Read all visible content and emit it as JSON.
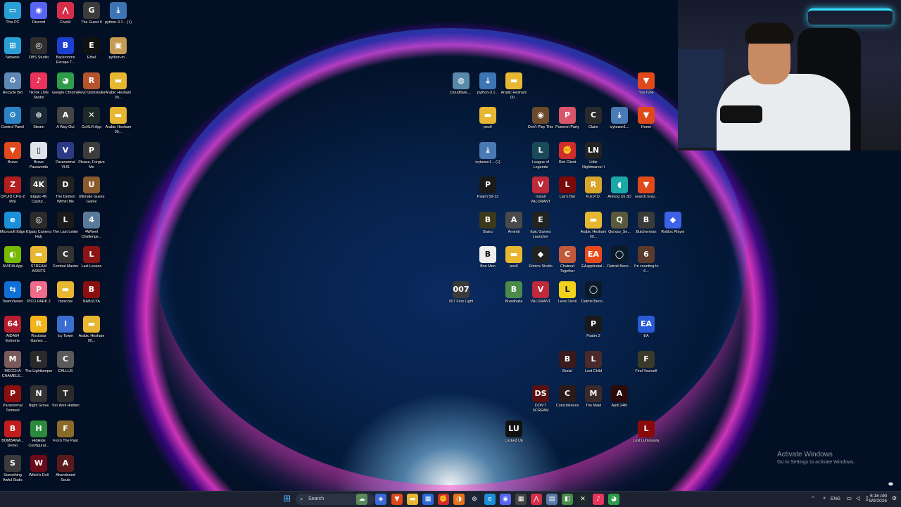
{
  "desktop_icons": [
    {
      "label": "This PC",
      "icon": "monitor-icon",
      "color": "#2a9fd6",
      "glyph": "▭"
    },
    {
      "label": "Discord",
      "icon": "discord-icon",
      "color": "#5865f2",
      "glyph": "◉"
    },
    {
      "label": "FiveM",
      "icon": "fivem-icon",
      "color": "#d62d4b",
      "glyph": "⋀"
    },
    {
      "label": "The Guest II",
      "icon": "game-icon",
      "color": "#3b3b3b",
      "glyph": "G"
    },
    {
      "label": "python-3.1... (1)",
      "icon": "python-installer-icon",
      "color": "#3c74b4",
      "glyph": "⤓"
    },
    {
      "label": "Network",
      "icon": "network-icon",
      "color": "#2a9fd6",
      "glyph": "⊞"
    },
    {
      "label": "OBS Studio",
      "icon": "obs-icon",
      "color": "#2e2e2e",
      "glyph": "◎"
    },
    {
      "label": "Backrooms Escape T...",
      "icon": "backrooms-icon",
      "color": "#1c3fd1",
      "glyph": "B"
    },
    {
      "label": "Ethel",
      "icon": "game-icon",
      "color": "#111",
      "glyph": "E"
    },
    {
      "label": "python-m...",
      "icon": "package-icon",
      "color": "#c59a52",
      "glyph": "▣"
    },
    {
      "label": "Recycle Bin",
      "icon": "recycle-bin-icon",
      "color": "#5f88b5",
      "glyph": "♻"
    },
    {
      "label": "TikTok LIVE Studio",
      "icon": "tiktok-icon",
      "color": "#e8335a",
      "glyph": "♪"
    },
    {
      "label": "Google Chrome",
      "icon": "chrome-icon",
      "color": "#2f9c4b",
      "glyph": "◕"
    },
    {
      "label": "Revo Uninstaller",
      "icon": "revo-icon",
      "color": "#b3542d",
      "glyph": "R"
    },
    {
      "label": "Arabic Hesham 00...",
      "icon": "folder-icon",
      "color": "#e7b731",
      "glyph": "▬"
    },
    {
      "label": "Control Panel",
      "icon": "control-panel-icon",
      "color": "#2d82c4",
      "glyph": "⚙"
    },
    {
      "label": "Steam",
      "icon": "steam-icon",
      "color": "#1b2838",
      "glyph": "⊛"
    },
    {
      "label": "A Way Out",
      "icon": "game-icon",
      "color": "#444",
      "glyph": "A"
    },
    {
      "label": "GoXLR App",
      "icon": "goxlr-icon",
      "color": "#1e2a2a",
      "glyph": "✕"
    },
    {
      "label": "Arabic Hesham 00...",
      "icon": "folder-icon",
      "color": "#e7b731",
      "glyph": "▬"
    },
    {
      "label": "Brave",
      "icon": "brave-icon",
      "color": "#e04a1b",
      "glyph": "▼"
    },
    {
      "label": "Brave Passwords",
      "icon": "file-icon",
      "color": "#dfe3ea",
      "glyph": "▯"
    },
    {
      "label": "Paranormal VHS",
      "icon": "vhs-icon",
      "color": "#2c3a86",
      "glyph": "V"
    },
    {
      "label": "Please, Forgive Me",
      "icon": "game-icon",
      "color": "#3c3c3c",
      "glyph": "P"
    },
    {
      "label": "CPUID CPU-Z MSI",
      "icon": "cpuz-icon",
      "color": "#b41e1e",
      "glyph": "Z"
    },
    {
      "label": "Elgato 4K Captur...",
      "icon": "elgato-icon",
      "color": "#333",
      "glyph": "4K"
    },
    {
      "label": "The Demon Within Me",
      "icon": "game-icon",
      "color": "#222",
      "glyph": "D"
    },
    {
      "label": "Ultimate Guess Game",
      "icon": "game-icon",
      "color": "#8a5b2d",
      "glyph": "U"
    },
    {
      "label": "Microsoft Edge",
      "icon": "edge-icon",
      "color": "#1b8fd8",
      "glyph": "e"
    },
    {
      "label": "Elgato Camera Hub",
      "icon": "camera-icon",
      "color": "#2b2b2b",
      "glyph": "◎"
    },
    {
      "label": "The Last Letter",
      "icon": "game-icon",
      "color": "#1a1a1a",
      "glyph": "L"
    },
    {
      "label": "4Wheel Challenge...",
      "icon": "game-icon",
      "color": "#5a7a9a",
      "glyph": "4"
    },
    {
      "label": "NVIDIA App",
      "icon": "nvidia-icon",
      "color": "#76b900",
      "glyph": "◐"
    },
    {
      "label": "STREAM ASSITS",
      "icon": "folder-icon",
      "color": "#e7b731",
      "glyph": "▬"
    },
    {
      "label": "Combat Master",
      "icon": "game-icon",
      "color": "#333",
      "glyph": "C"
    },
    {
      "label": "Last Lesson",
      "icon": "game-icon",
      "color": "#8a1515",
      "glyph": "L"
    },
    {
      "label": "TeamViewer",
      "icon": "teamviewer-icon",
      "color": "#0e6fd6",
      "glyph": "⇆"
    },
    {
      "label": "PICO PARK 2",
      "icon": "pico-icon",
      "color": "#f06a8a",
      "glyph": "P"
    },
    {
      "label": "moscow",
      "icon": "folder-icon",
      "color": "#e7b731",
      "glyph": "▬"
    },
    {
      "label": "BABULYA",
      "icon": "game-icon",
      "color": "#8a1010",
      "glyph": "B"
    },
    {
      "label": "AIDA64 Extreme",
      "icon": "aida64-icon",
      "color": "#b41e2e",
      "glyph": "64"
    },
    {
      "label": "Rockstar Games ...",
      "icon": "rockstar-icon",
      "color": "#f3b41a",
      "glyph": "R"
    },
    {
      "label": "Icy Tower",
      "icon": "game-icon",
      "color": "#3a6fd1",
      "glyph": "I"
    },
    {
      "label": "Arabic Hesham 00...",
      "icon": "folder-icon",
      "color": "#e7b731",
      "glyph": "▬"
    },
    {
      "label": "MECCHA CHAMELE...",
      "icon": "game-icon",
      "color": "#7a5a5a",
      "glyph": "M"
    },
    {
      "label": "The Lightkeeper",
      "icon": "game-icon",
      "color": "#2a2a2a",
      "glyph": "L"
    },
    {
      "label": "CALLUS",
      "icon": "game-icon",
      "color": "#5a5a5a",
      "glyph": "C"
    },
    {
      "label": "Paranormal Torment",
      "icon": "game-icon",
      "color": "#8a1010",
      "glyph": "P"
    },
    {
      "label": "Night Grove",
      "icon": "game-icon",
      "color": "#333",
      "glyph": "N"
    },
    {
      "label": "Too Well Hidden",
      "icon": "game-icon",
      "color": "#2a2a2a",
      "glyph": "T"
    },
    {
      "label": "BOMBANA... Demo",
      "icon": "game-icon",
      "color": "#c21c1c",
      "glyph": "B"
    },
    {
      "label": "HidHide Configurat...",
      "icon": "hidhide-icon",
      "color": "#2c8a3c",
      "glyph": "H"
    },
    {
      "label": "From The Past",
      "icon": "game-icon",
      "color": "#8a6a2a",
      "glyph": "F"
    },
    {
      "label": "Something Awful Static",
      "icon": "game-icon",
      "color": "#3a3a3a",
      "glyph": "S"
    },
    {
      "label": "Witch's Doll",
      "icon": "game-icon",
      "color": "#6a0a1a",
      "glyph": "W"
    },
    {
      "label": "Abandoned Souls",
      "icon": "game-icon",
      "color": "#5a1a1a",
      "glyph": "A"
    },
    {
      "label": "Cloudflare_...",
      "icon": "cloudflare-installer-icon",
      "color": "#5a8aaa",
      "glyph": "◍"
    },
    {
      "label": "python-3.1...",
      "icon": "python-installer-icon",
      "color": "#3c74b4",
      "glyph": "⤓"
    },
    {
      "label": "Arabic Hesham 00...",
      "icon": "folder-icon",
      "color": "#e7b731",
      "glyph": "▬"
    },
    {
      "label": "YouTube",
      "icon": "brave-icon",
      "color": "#e04a1b",
      "glyph": "▼"
    },
    {
      "label": "pes6",
      "icon": "folder-icon",
      "color": "#e7b731",
      "glyph": "▬"
    },
    {
      "label": "Don't Play This",
      "icon": "game-icon",
      "color": "#6a4a2a",
      "glyph": "◉"
    },
    {
      "label": "Pummel Party",
      "icon": "game-icon",
      "color": "#d8566a",
      "glyph": "P"
    },
    {
      "label": "Claire",
      "icon": "game-icon",
      "color": "#2a2a2a",
      "glyph": "C"
    },
    {
      "label": "icytower1...",
      "icon": "installer-icon",
      "color": "#4a7ab4",
      "glyph": "⤓"
    },
    {
      "label": "Home",
      "icon": "brave-icon",
      "color": "#e04a1b",
      "glyph": "▼"
    },
    {
      "label": "icytower1... (1)",
      "icon": "installer-icon",
      "color": "#4a7ab4",
      "glyph": "⤓"
    },
    {
      "label": "League of Legends",
      "icon": "league-icon",
      "color": "#1a4a5a",
      "glyph": "L"
    },
    {
      "label": "Riot Client",
      "icon": "riot-icon",
      "color": "#d12c2c",
      "glyph": "✊"
    },
    {
      "label": "Little Nightmares II",
      "icon": "game-icon",
      "color": "#222",
      "glyph": "LN"
    },
    {
      "label": "Psalm 59-13",
      "icon": "game-icon",
      "color": "#1a1a1a",
      "glyph": "P"
    },
    {
      "label": "Install VALORANT",
      "icon": "valorant-icon",
      "color": "#bd2a3a",
      "glyph": "V"
    },
    {
      "label": "Liar's Bar",
      "icon": "game-icon",
      "color": "#7a0a0a",
      "glyph": "L"
    },
    {
      "label": "R.E.P.O.",
      "icon": "repo-icon",
      "color": "#d8a42a",
      "glyph": "R"
    },
    {
      "label": "Among Us 3D",
      "icon": "amongus-icon",
      "color": "#1aa8a8",
      "glyph": "◖"
    },
    {
      "label": "search.brav...",
      "icon": "brave-icon",
      "color": "#e04a1b",
      "glyph": "▼"
    },
    {
      "label": "Baisu",
      "icon": "game-icon",
      "color": "#3a3a1a",
      "glyph": "B"
    },
    {
      "label": "Amenti",
      "icon": "game-icon",
      "color": "#4a4a4a",
      "glyph": "A"
    },
    {
      "label": "Epic Games Launcher",
      "icon": "epic-icon",
      "color": "#222",
      "glyph": "E"
    },
    {
      "label": "Arabic Hesham 00...",
      "icon": "folder-icon",
      "color": "#e7b731",
      "glyph": "▬"
    },
    {
      "label": "Qorsan_Se...",
      "icon": "game-icon",
      "color": "#5a5a3a",
      "glyph": "Q"
    },
    {
      "label": "Butcherman",
      "icon": "game-icon",
      "color": "#3a3a3a",
      "glyph": "B"
    },
    {
      "label": "Roblox Player",
      "icon": "roblox-icon",
      "color": "#3d62e8",
      "glyph": "◆"
    },
    {
      "label": "Boo Men",
      "icon": "game-icon",
      "color": "#eee",
      "glyph": "B"
    },
    {
      "label": "pes6",
      "icon": "folder-icon",
      "color": "#e7b731",
      "glyph": "▬"
    },
    {
      "label": "Roblox Studio",
      "icon": "roblox-studio-icon",
      "color": "#222",
      "glyph": "◆"
    },
    {
      "label": "Chained Together",
      "icon": "game-icon",
      "color": "#c25a3a",
      "glyph": "C"
    },
    {
      "label": "EAappInstal...",
      "icon": "ea-icon",
      "color": "#e84a1a",
      "glyph": "EA"
    },
    {
      "label": "Detroit Beco...",
      "icon": "detroit-icon",
      "color": "#0a1a2a",
      "glyph": "◯"
    },
    {
      "label": "I'm counting to 6...",
      "icon": "game-icon",
      "color": "#5a3a2a",
      "glyph": "6"
    },
    {
      "label": "007 First Light",
      "icon": "game-icon",
      "color": "#3a3a3a",
      "glyph": "007"
    },
    {
      "label": "Brawlhalla",
      "icon": "game-icon",
      "color": "#4a8a4a",
      "glyph": "B"
    },
    {
      "label": "VALORANT",
      "icon": "valorant-icon",
      "color": "#bd2a3a",
      "glyph": "V"
    },
    {
      "label": "Level Devil",
      "icon": "game-icon",
      "color": "#f2d21a",
      "glyph": "L"
    },
    {
      "label": "Detroit Beco...",
      "icon": "detroit-icon",
      "color": "#0a1a2a",
      "glyph": "◯"
    },
    {
      "label": "Psalm 2",
      "icon": "game-icon",
      "color": "#1a1a1a",
      "glyph": "P"
    },
    {
      "label": "EA",
      "icon": "ea-icon",
      "color": "#2a5ad8",
      "glyph": "EA"
    },
    {
      "label": "Burial",
      "icon": "game-icon",
      "color": "#3a1a1a",
      "glyph": "B"
    },
    {
      "label": "Lost Child",
      "icon": "game-icon",
      "color": "#4a2a2a",
      "glyph": "L"
    },
    {
      "label": "Find Yourself",
      "icon": "game-icon",
      "color": "#3a3a2a",
      "glyph": "F"
    },
    {
      "label": "DON'T SCREAM",
      "icon": "game-icon",
      "color": "#5a1010",
      "glyph": "DS"
    },
    {
      "label": "Coincidences",
      "icon": "game-icon",
      "color": "#2a1a1a",
      "glyph": "C"
    },
    {
      "label": "The Maid",
      "icon": "game-icon",
      "color": "#3a2a2a",
      "glyph": "M"
    },
    {
      "label": "April 24th",
      "icon": "game-icon",
      "color": "#2a0a0a",
      "glyph": "A"
    },
    {
      "label": "Locked Up",
      "icon": "game-icon",
      "color": "#111",
      "glyph": "LU"
    },
    {
      "label": "Lost Luminosity",
      "icon": "game-icon",
      "color": "#8a0a0a",
      "glyph": "L"
    }
  ],
  "watermark": {
    "title": "Activate Windows",
    "subtitle": "Go to Settings to activate Windows."
  },
  "taskbar": {
    "search_placeholder": "Search",
    "start_icon": "windows-start-icon",
    "apps": [
      {
        "icon": "widgets-icon",
        "color": "#5a8a5a",
        "glyph": "☁"
      },
      {
        "icon": "copilot-icon",
        "color": "#3a6ad8",
        "glyph": "◈"
      },
      {
        "icon": "brave-icon",
        "color": "#e04a1b",
        "glyph": "▼"
      },
      {
        "icon": "file-explorer-icon",
        "color": "#e7b731",
        "glyph": "▬"
      },
      {
        "icon": "ms-store-icon",
        "color": "#2a6ad8",
        "glyph": "▦"
      },
      {
        "icon": "riot-icon",
        "color": "#d12c2c",
        "glyph": "✊"
      },
      {
        "icon": "firefox-icon",
        "color": "#e8741a",
        "glyph": "◑"
      },
      {
        "icon": "steam-icon",
        "color": "#1b2838",
        "glyph": "⊛"
      },
      {
        "icon": "edge-icon",
        "color": "#1b8fd8",
        "glyph": "e"
      },
      {
        "icon": "discord-icon",
        "color": "#5865f2",
        "glyph": "◉"
      },
      {
        "icon": "calculator-icon",
        "color": "#444",
        "glyph": "▦"
      },
      {
        "icon": "fivem-icon",
        "color": "#d62d4b",
        "glyph": "⋀"
      },
      {
        "icon": "notepad-icon",
        "color": "#5a7aa8",
        "glyph": "▤"
      },
      {
        "icon": "app-icon",
        "color": "#4a8a4a",
        "glyph": "◧"
      },
      {
        "icon": "goxlr-icon",
        "color": "#1e2a2a",
        "glyph": "✕"
      },
      {
        "icon": "tiktok-icon",
        "color": "#e8335a",
        "glyph": "♪"
      },
      {
        "icon": "chrome-icon",
        "color": "#2f9c4b",
        "glyph": "◕"
      }
    ],
    "language": "ENG",
    "time": "6:16 AM",
    "date": "8/9/2026"
  }
}
